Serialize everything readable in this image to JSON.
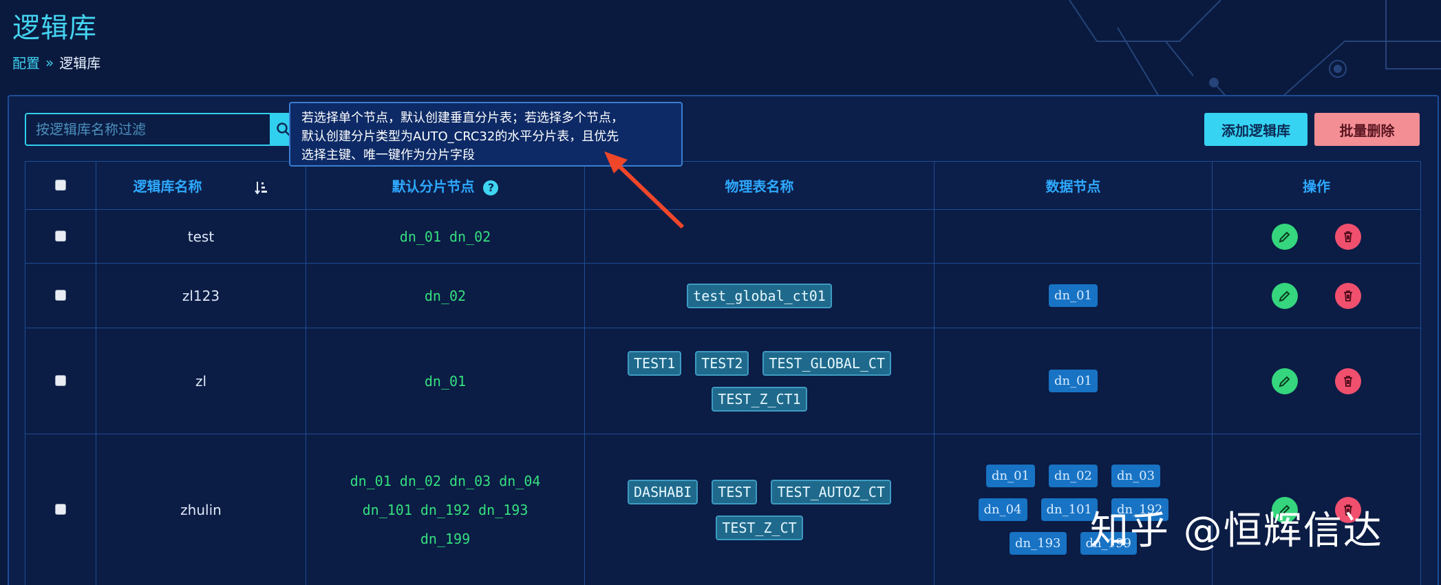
{
  "header": {
    "title": "逻辑库",
    "breadcrumb": {
      "parent": "配置",
      "separator": "»",
      "current": "逻辑库"
    }
  },
  "toolbar": {
    "search_placeholder": "按逻辑库名称过滤",
    "add_label": "添加逻辑库",
    "batch_delete_label": "批量删除"
  },
  "tooltip": {
    "line1": "若选择单个节点，默认创建垂直分片表；若选择多个节点，",
    "line2": "默认创建分片类型为AUTO_CRC32的水平分片表，且优先",
    "line3": "选择主键、唯一键作为分片字段"
  },
  "table": {
    "columns": {
      "name": "逻辑库名称",
      "default_nodes": "默认分片节点",
      "physical_tables": "物理表名称",
      "data_nodes": "数据节点",
      "actions": "操作"
    },
    "rows": [
      {
        "name": "test",
        "default_nodes": [
          "dn_01",
          "dn_02"
        ],
        "physical_tables": [],
        "data_nodes": []
      },
      {
        "name": "zl123",
        "default_nodes": [
          "dn_02"
        ],
        "physical_tables": [
          "test_global_ct01"
        ],
        "data_nodes": [
          "dn_01"
        ]
      },
      {
        "name": "zl",
        "default_nodes": [
          "dn_01"
        ],
        "physical_tables": [
          "TEST1",
          "TEST2",
          "TEST_GLOBAL_CT",
          "TEST_Z_CT1"
        ],
        "data_nodes": [
          "dn_01"
        ]
      },
      {
        "name": "zhulin",
        "default_nodes": [
          "dn_01",
          "dn_02",
          "dn_03",
          "dn_04",
          "dn_101",
          "dn_192",
          "dn_193",
          "dn_199"
        ],
        "physical_tables": [
          "DASHABI",
          "TEST",
          "TEST_AUTOZ_CT",
          "TEST_Z_CT"
        ],
        "data_nodes": [
          "dn_01",
          "dn_02",
          "dn_03",
          "dn_04",
          "dn_101",
          "dn_192",
          "dn_193",
          "dn_199"
        ]
      }
    ]
  },
  "watermark": "知乎 @恒辉信达",
  "colors": {
    "accent": "#31d0ee",
    "node_green": "#35e07e",
    "danger": "#f0506e"
  }
}
